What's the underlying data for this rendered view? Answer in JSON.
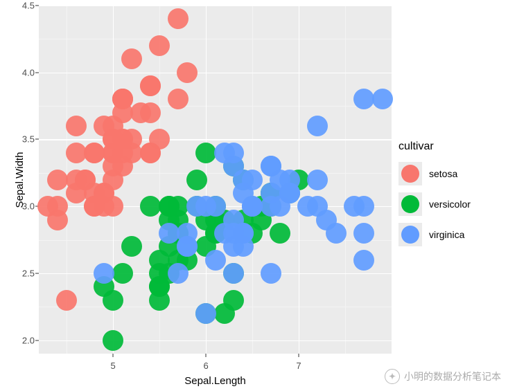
{
  "chart_data": {
    "type": "scatter",
    "xlabel": "Sepal.Length",
    "ylabel": "Sepal.Width",
    "xlim": [
      4.2,
      8.0
    ],
    "ylim": [
      1.9,
      4.5
    ],
    "x_ticks": [
      5,
      6,
      7
    ],
    "y_ticks": [
      2.0,
      2.5,
      3.0,
      3.5,
      4.0,
      4.5
    ],
    "legend_title": "cultivar",
    "annotations": {
      "watermark": "小明的数据分析笔记本"
    },
    "series": [
      {
        "name": "setosa",
        "color": "#f8766d",
        "points": [
          {
            "x": 5.1,
            "y": 3.5
          },
          {
            "x": 4.9,
            "y": 3.0
          },
          {
            "x": 4.7,
            "y": 3.2
          },
          {
            "x": 4.6,
            "y": 3.1
          },
          {
            "x": 5.0,
            "y": 3.6
          },
          {
            "x": 5.4,
            "y": 3.9
          },
          {
            "x": 4.6,
            "y": 3.4
          },
          {
            "x": 5.0,
            "y": 3.4
          },
          {
            "x": 4.4,
            "y": 2.9
          },
          {
            "x": 4.9,
            "y": 3.1
          },
          {
            "x": 5.4,
            "y": 3.7
          },
          {
            "x": 4.8,
            "y": 3.4
          },
          {
            "x": 4.8,
            "y": 3.0
          },
          {
            "x": 4.3,
            "y": 3.0
          },
          {
            "x": 5.8,
            "y": 4.0
          },
          {
            "x": 5.7,
            "y": 4.4
          },
          {
            "x": 5.4,
            "y": 3.9
          },
          {
            "x": 5.1,
            "y": 3.5
          },
          {
            "x": 5.7,
            "y": 3.8
          },
          {
            "x": 5.1,
            "y": 3.8
          },
          {
            "x": 5.4,
            "y": 3.4
          },
          {
            "x": 5.1,
            "y": 3.7
          },
          {
            "x": 4.6,
            "y": 3.6
          },
          {
            "x": 5.1,
            "y": 3.3
          },
          {
            "x": 4.8,
            "y": 3.4
          },
          {
            "x": 5.0,
            "y": 3.0
          },
          {
            "x": 5.0,
            "y": 3.4
          },
          {
            "x": 5.2,
            "y": 3.5
          },
          {
            "x": 5.2,
            "y": 3.4
          },
          {
            "x": 4.7,
            "y": 3.2
          },
          {
            "x": 4.8,
            "y": 3.1
          },
          {
            "x": 5.4,
            "y": 3.4
          },
          {
            "x": 5.2,
            "y": 4.1
          },
          {
            "x": 5.5,
            "y": 4.2
          },
          {
            "x": 4.9,
            "y": 3.1
          },
          {
            "x": 5.0,
            "y": 3.2
          },
          {
            "x": 5.5,
            "y": 3.5
          },
          {
            "x": 4.9,
            "y": 3.6
          },
          {
            "x": 4.4,
            "y": 3.0
          },
          {
            "x": 5.1,
            "y": 3.4
          },
          {
            "x": 5.0,
            "y": 3.5
          },
          {
            "x": 4.5,
            "y": 2.3
          },
          {
            "x": 4.4,
            "y": 3.2
          },
          {
            "x": 5.0,
            "y": 3.5
          },
          {
            "x": 5.1,
            "y": 3.8
          },
          {
            "x": 4.8,
            "y": 3.0
          },
          {
            "x": 5.1,
            "y": 3.8
          },
          {
            "x": 4.6,
            "y": 3.2
          },
          {
            "x": 5.3,
            "y": 3.7
          },
          {
            "x": 5.0,
            "y": 3.3
          }
        ]
      },
      {
        "name": "versicolor",
        "color": "#00ba38",
        "points": [
          {
            "x": 7.0,
            "y": 3.2
          },
          {
            "x": 6.4,
            "y": 3.2
          },
          {
            "x": 6.9,
            "y": 3.1
          },
          {
            "x": 5.5,
            "y": 2.3
          },
          {
            "x": 6.5,
            "y": 2.8
          },
          {
            "x": 5.7,
            "y": 2.8
          },
          {
            "x": 6.3,
            "y": 3.3
          },
          {
            "x": 4.9,
            "y": 2.4
          },
          {
            "x": 6.6,
            "y": 2.9
          },
          {
            "x": 5.2,
            "y": 2.7
          },
          {
            "x": 5.0,
            "y": 2.0
          },
          {
            "x": 5.9,
            "y": 3.0
          },
          {
            "x": 6.0,
            "y": 2.2
          },
          {
            "x": 6.1,
            "y": 2.9
          },
          {
            "x": 5.6,
            "y": 2.9
          },
          {
            "x": 6.7,
            "y": 3.1
          },
          {
            "x": 5.6,
            "y": 3.0
          },
          {
            "x": 5.8,
            "y": 2.7
          },
          {
            "x": 6.2,
            "y": 2.2
          },
          {
            "x": 5.6,
            "y": 2.5
          },
          {
            "x": 5.9,
            "y": 3.2
          },
          {
            "x": 6.1,
            "y": 2.8
          },
          {
            "x": 6.3,
            "y": 2.5
          },
          {
            "x": 6.1,
            "y": 2.8
          },
          {
            "x": 6.4,
            "y": 2.9
          },
          {
            "x": 6.6,
            "y": 3.0
          },
          {
            "x": 6.8,
            "y": 2.8
          },
          {
            "x": 6.7,
            "y": 3.0
          },
          {
            "x": 6.0,
            "y": 2.9
          },
          {
            "x": 5.7,
            "y": 2.6
          },
          {
            "x": 5.5,
            "y": 2.4
          },
          {
            "x": 5.5,
            "y": 2.4
          },
          {
            "x": 5.8,
            "y": 2.7
          },
          {
            "x": 6.0,
            "y": 2.7
          },
          {
            "x": 5.4,
            "y": 3.0
          },
          {
            "x": 6.0,
            "y": 3.4
          },
          {
            "x": 6.7,
            "y": 3.1
          },
          {
            "x": 6.3,
            "y": 2.3
          },
          {
            "x": 5.6,
            "y": 3.0
          },
          {
            "x": 5.5,
            "y": 2.5
          },
          {
            "x": 5.5,
            "y": 2.6
          },
          {
            "x": 6.1,
            "y": 3.0
          },
          {
            "x": 5.8,
            "y": 2.6
          },
          {
            "x": 5.0,
            "y": 2.3
          },
          {
            "x": 5.6,
            "y": 2.7
          },
          {
            "x": 5.7,
            "y": 3.0
          },
          {
            "x": 5.7,
            "y": 2.9
          },
          {
            "x": 6.2,
            "y": 2.9
          },
          {
            "x": 5.1,
            "y": 2.5
          },
          {
            "x": 5.7,
            "y": 2.8
          }
        ]
      },
      {
        "name": "virginica",
        "color": "#619cff",
        "points": [
          {
            "x": 6.3,
            "y": 3.3
          },
          {
            "x": 5.8,
            "y": 2.7
          },
          {
            "x": 7.1,
            "y": 3.0
          },
          {
            "x": 6.3,
            "y": 2.9
          },
          {
            "x": 6.5,
            "y": 3.0
          },
          {
            "x": 7.6,
            "y": 3.0
          },
          {
            "x": 4.9,
            "y": 2.5
          },
          {
            "x": 7.3,
            "y": 2.9
          },
          {
            "x": 6.7,
            "y": 2.5
          },
          {
            "x": 7.2,
            "y": 3.6
          },
          {
            "x": 6.5,
            "y": 3.2
          },
          {
            "x": 6.4,
            "y": 2.7
          },
          {
            "x": 6.8,
            "y": 3.0
          },
          {
            "x": 5.7,
            "y": 2.5
          },
          {
            "x": 5.8,
            "y": 2.8
          },
          {
            "x": 6.4,
            "y": 3.2
          },
          {
            "x": 6.5,
            "y": 3.0
          },
          {
            "x": 7.7,
            "y": 3.8
          },
          {
            "x": 7.7,
            "y": 2.6
          },
          {
            "x": 6.0,
            "y": 2.2
          },
          {
            "x": 6.9,
            "y": 3.2
          },
          {
            "x": 5.6,
            "y": 2.8
          },
          {
            "x": 7.7,
            "y": 2.8
          },
          {
            "x": 6.3,
            "y": 2.7
          },
          {
            "x": 6.7,
            "y": 3.3
          },
          {
            "x": 7.2,
            "y": 3.2
          },
          {
            "x": 6.2,
            "y": 2.8
          },
          {
            "x": 6.1,
            "y": 3.0
          },
          {
            "x": 6.4,
            "y": 2.8
          },
          {
            "x": 7.2,
            "y": 3.0
          },
          {
            "x": 7.4,
            "y": 2.8
          },
          {
            "x": 7.9,
            "y": 3.8
          },
          {
            "x": 6.4,
            "y": 2.8
          },
          {
            "x": 6.3,
            "y": 2.8
          },
          {
            "x": 6.1,
            "y": 2.6
          },
          {
            "x": 7.7,
            "y": 3.0
          },
          {
            "x": 6.3,
            "y": 3.4
          },
          {
            "x": 6.4,
            "y": 3.1
          },
          {
            "x": 6.0,
            "y": 3.0
          },
          {
            "x": 6.9,
            "y": 3.1
          },
          {
            "x": 6.7,
            "y": 3.1
          },
          {
            "x": 6.9,
            "y": 3.1
          },
          {
            "x": 5.8,
            "y": 2.7
          },
          {
            "x": 6.8,
            "y": 3.2
          },
          {
            "x": 6.7,
            "y": 3.3
          },
          {
            "x": 6.7,
            "y": 3.0
          },
          {
            "x": 6.3,
            "y": 2.5
          },
          {
            "x": 6.5,
            "y": 3.0
          },
          {
            "x": 6.2,
            "y": 3.4
          },
          {
            "x": 5.9,
            "y": 3.0
          }
        ]
      }
    ]
  }
}
